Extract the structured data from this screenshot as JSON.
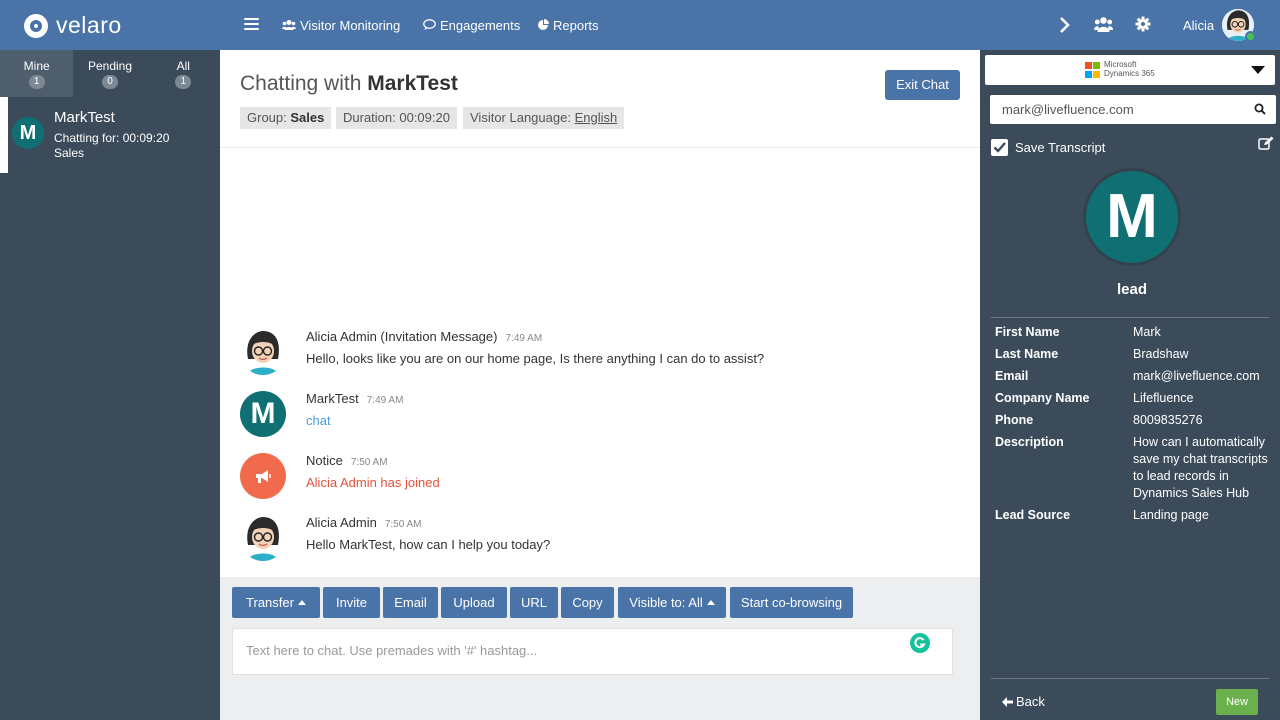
{
  "app": {
    "logo_text": "velaro"
  },
  "nav": {
    "visitor_monitoring": "Visitor Monitoring",
    "engagements": "Engagements",
    "reports": "Reports",
    "user_name": "Alicia"
  },
  "sidebar": {
    "tabs": [
      {
        "label": "Mine",
        "count": "1"
      },
      {
        "label": "Pending",
        "count": "0"
      },
      {
        "label": "All",
        "count": "1"
      }
    ],
    "chat": {
      "initial": "M",
      "name": "MarkTest",
      "duration": "Chatting for: 00:09:20",
      "group": "Sales"
    }
  },
  "main": {
    "title_prefix": "Chatting with",
    "title_name": "MarkTest",
    "exit_label": "Exit Chat",
    "group_label": "Group:",
    "group_value": "Sales",
    "duration": "Duration: 00:09:20",
    "language_label": "Visitor Language:",
    "language_value": "English",
    "messages": [
      {
        "who": "Alicia Admin (Invitation Message)",
        "time": "7:49 AM",
        "text": "Hello, looks like you are on our home page, Is there anything I can do to assist?"
      },
      {
        "who": "MarkTest",
        "time": "7:49 AM",
        "text": "chat",
        "initial": "M"
      },
      {
        "who": "Notice",
        "time": "7:50 AM",
        "text": "Alicia Admin has joined"
      },
      {
        "who": "Alicia Admin",
        "time": "7:50 AM",
        "text": "Hello MarkTest, how can I help you today?"
      }
    ],
    "buttons": {
      "transfer": "Transfer",
      "invite": "Invite",
      "email": "Email",
      "upload": "Upload",
      "url": "URL",
      "copy": "Copy",
      "visible": "Visible to: All",
      "cobrowse": "Start co-browsing"
    },
    "input_placeholder": "Text here to chat. Use premades with '#' hashtag..."
  },
  "right": {
    "crm_line1": "Microsoft",
    "crm_line2": "Dynamics 365",
    "search_value": "mark@livefluence.com",
    "save_transcript": "Save Transcript",
    "avatar_initial": "M",
    "record_type": "lead",
    "fields": [
      {
        "label": "First Name",
        "value": "Mark"
      },
      {
        "label": "Last Name",
        "value": "Bradshaw"
      },
      {
        "label": "Email",
        "value": "mark@livefluence.com"
      },
      {
        "label": "Company Name",
        "value": "Lifefluence"
      },
      {
        "label": "Phone",
        "value": "8009835276"
      },
      {
        "label": "Description",
        "value": "How can I automatically save my chat transcripts to lead records in Dynamics Sales Hub"
      },
      {
        "label": "Lead Source",
        "value": "Landing page"
      }
    ],
    "back_label": "Back",
    "new_label": "New"
  },
  "colors": {
    "brand": "#4a74a8",
    "sidebar": "#3b4b5a",
    "avatar_teal": "#0f6f73",
    "notice": "#f06a4b",
    "link_blue": "#4a9fd8",
    "new_green": "#6ab04c"
  }
}
